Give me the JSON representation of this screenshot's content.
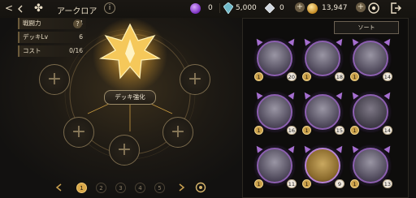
{
  "header": {
    "title": "アークロア",
    "info": "i",
    "resources": [
      {
        "icon": "purple-orb-icon",
        "value": "0"
      },
      {
        "icon": "crystal-icon",
        "value": "5,000"
      },
      {
        "icon": "diamond-icon",
        "value": "0"
      },
      {
        "icon": "gold-coin-icon",
        "value": "13,947"
      }
    ]
  },
  "stats": [
    {
      "label": "戦闘力",
      "value": "44"
    },
    {
      "label": "デッキLv",
      "value": "6"
    },
    {
      "label": "コスト",
      "value": "0/16"
    }
  ],
  "deck": {
    "strengthen_label": "デッキ強化",
    "pages": [
      "1",
      "2",
      "3",
      "4",
      "5"
    ]
  },
  "panel": {
    "sort_label": "ソート",
    "cards": [
      {
        "level": "1",
        "count": "20"
      },
      {
        "level": "1",
        "count": "18"
      },
      {
        "level": "1",
        "count": "14"
      },
      {
        "level": "1",
        "count": "16"
      },
      {
        "level": "1",
        "count": "15"
      },
      {
        "level": "1",
        "count": "14"
      },
      {
        "level": "1",
        "count": "11"
      },
      {
        "level": "1",
        "count": "9"
      },
      {
        "level": "1",
        "count": "13"
      }
    ]
  },
  "colors": {
    "accent": "#d9a84a",
    "frame": "#8c5fb0"
  }
}
